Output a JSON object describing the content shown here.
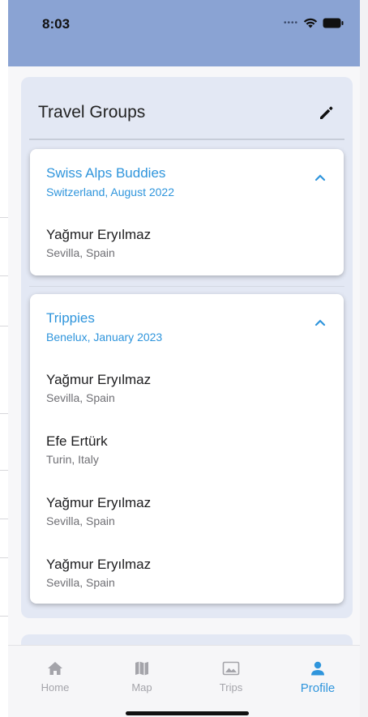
{
  "status_bar": {
    "time": "8:03",
    "signal_icon": "cellular-dots-icon",
    "wifi_icon": "wifi-icon",
    "battery_icon": "battery-icon"
  },
  "title": "Travel Groups",
  "edit_icon": "pencil-icon",
  "groups": [
    {
      "name": "Swiss Alps Buddies",
      "subtitle": "Switzerland, August 2022",
      "members": [
        {
          "name": "Yağmur Eryılmaz",
          "location": "Sevilla, Spain"
        }
      ]
    },
    {
      "name": "Trippies",
      "subtitle": "Benelux, January 2023",
      "members": [
        {
          "name": "Yağmur Eryılmaz",
          "location": "Sevilla, Spain"
        },
        {
          "name": "Efe Ertürk",
          "location": "Turin, Italy"
        },
        {
          "name": "Yağmur Eryılmaz",
          "location": "Sevilla, Spain"
        },
        {
          "name": "Yağmur Eryılmaz",
          "location": "Sevilla, Spain"
        }
      ]
    }
  ],
  "tabs": [
    {
      "label": "Home",
      "icon": "home-icon"
    },
    {
      "label": "Map",
      "icon": "map-icon"
    },
    {
      "label": "Trips",
      "icon": "photo-icon"
    },
    {
      "label": "Profile",
      "icon": "person-icon",
      "active": true
    }
  ],
  "colors": {
    "accent": "#2f95dc",
    "header": "#8aa3d3",
    "panel": "#e3e8f4"
  }
}
